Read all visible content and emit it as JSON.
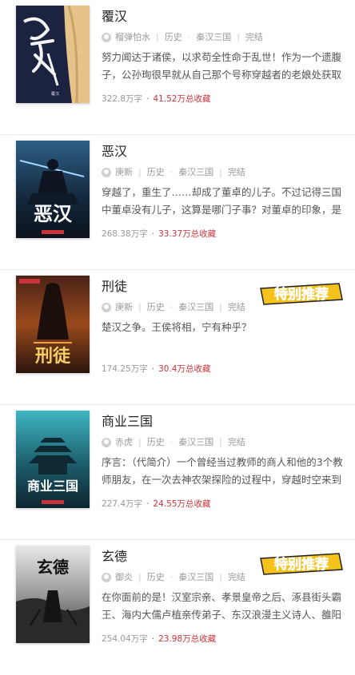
{
  "books": [
    {
      "title": "覆汉",
      "author": "榴弹怕水",
      "category": "历史",
      "subcategory": "秦汉三国",
      "status": "完结",
      "description": "努力闻达于诸侯，以求苟全性命于乱世！作为一个遗腹子，公孙珣很早就从自己那个号称穿越者的老娘处获取",
      "word_count": "322.8万字",
      "favorites": "41.52万总收藏",
      "cover_text": "覆汉",
      "featured": false
    },
    {
      "title": "恶汉",
      "author": "庚新",
      "category": "历史",
      "subcategory": "秦汉三国",
      "status": "完结",
      "description": "穿越了，重生了……却成了董卓的儿子。不过记得三国中董卓没有儿子，这算是哪门子事？对董卓的印象，是",
      "word_count": "268.38万字",
      "favorites": "33.37万总收藏",
      "cover_text": "恶汉",
      "featured": false
    },
    {
      "title": "刑徒",
      "author": "庚新",
      "category": "历史",
      "subcategory": "秦汉三国",
      "status": "完结",
      "description": "楚汉之争。王侯将相，宁有种乎？",
      "word_count": "174.25万字",
      "favorites": "30.4万总收藏",
      "cover_text": "刑徒",
      "featured": true
    },
    {
      "title": "商业三国",
      "author": "赤虎",
      "category": "历史",
      "subcategory": "秦汉三国",
      "status": "完结",
      "description": "序言：（代简介）一个曾经当过教师的商人和他的3个教师朋友，在一次去神农架探险的过程中，穿越时空来到",
      "word_count": "227.4万字",
      "favorites": "24.55万总收藏",
      "cover_text": "商业三国",
      "featured": false
    },
    {
      "title": "玄德",
      "author": "御炎",
      "category": "历史",
      "subcategory": "秦汉三国",
      "status": "完结",
      "description": "在你面前的是！汉室宗亲、孝景皇帝之后、涿县街头霸王、海内大儒卢植亲传弟子、东汉浪漫主义诗人、雒阳",
      "word_count": "254.04万字",
      "favorites": "23.98万总收藏",
      "cover_text": "玄德",
      "featured": true
    }
  ],
  "badge_text": "特别推荐",
  "colors": {
    "accent": "#c8343c",
    "badge_yellow": "#f5c21b",
    "badge_dark": "#1f1f1f"
  }
}
